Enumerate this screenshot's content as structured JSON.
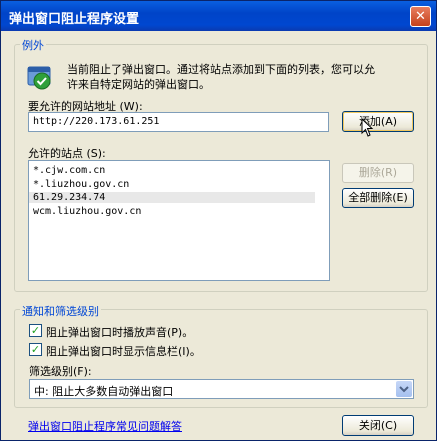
{
  "window": {
    "title": "弹出窗口阻止程序设置",
    "close_glyph": "✕"
  },
  "exceptions": {
    "legend": "例外",
    "info_line1": "当前阻止了弹出窗口。通过将站点添加到下面的列表，您可以允",
    "info_line2": "许来自特定网站的弹出窗口。",
    "address_label": "要允许的网站地址 (W):",
    "address_value": "http://220.173.61.251",
    "add_button": "添加(A)",
    "allowed_label": "允许的站点 (S):",
    "sites": [
      "*.cjw.com.cn",
      "*.liuzhou.gov.cn",
      "61.29.234.74",
      "wcm.liuzhou.gov.cn"
    ],
    "remove_button": "删除(R)",
    "remove_all_button": "全部删除(E)"
  },
  "notification": {
    "legend": "通知和筛选级别",
    "play_sound": {
      "label": "阻止弹出窗口时播放声音(P)。",
      "checked": true
    },
    "show_info_bar": {
      "label": "阻止弹出窗口时显示信息栏(I)。",
      "checked": true
    },
    "filter_label": "筛选级别(F):",
    "filter_value": "中: 阻止大多数自动弹出窗口"
  },
  "footer": {
    "faq_link": "弹出窗口阻止程序常见问题解答",
    "close_button": "关闭(C)"
  },
  "icons": {
    "shield": "shield-icon",
    "dropdown": "chevron-down-icon",
    "cursor": "mouse-pointer-icon"
  }
}
